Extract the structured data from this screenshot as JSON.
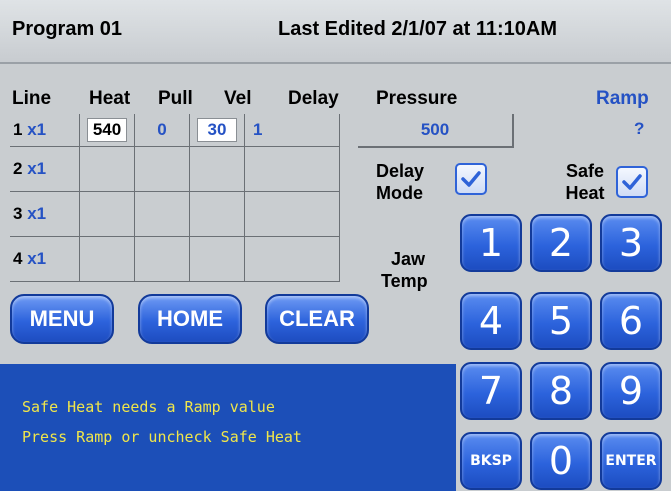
{
  "header": {
    "program_title": "Program 01",
    "last_edited": "Last Edited 2/1/07 at 11:10AM"
  },
  "table": {
    "columns": [
      "Line",
      "Heat",
      "Pull",
      "Vel",
      "Delay",
      "Pressure",
      "Ramp"
    ],
    "rows": [
      {
        "line": "1",
        "mult": "x1",
        "heat": "540",
        "pull": "0",
        "vel": "30",
        "delay": "1"
      },
      {
        "line": "2",
        "mult": "x1",
        "heat": "",
        "pull": "",
        "vel": "",
        "delay": ""
      },
      {
        "line": "3",
        "mult": "x1",
        "heat": "",
        "pull": "",
        "vel": "",
        "delay": ""
      },
      {
        "line": "4",
        "mult": "x1",
        "heat": "",
        "pull": "",
        "vel": "",
        "delay": ""
      }
    ],
    "pressure_value": "500",
    "ramp_value": "?"
  },
  "options": {
    "delay_mode_line1": "Delay",
    "delay_mode_line2": "Mode",
    "delay_mode_checked": true,
    "safe_heat_line1": "Safe",
    "safe_heat_line2": "Heat",
    "safe_heat_checked": true,
    "jaw_temp_line1": "Jaw",
    "jaw_temp_line2": "Temp"
  },
  "buttons": {
    "menu": "MENU",
    "home": "HOME",
    "clear": "CLEAR"
  },
  "keypad": {
    "k1": "1",
    "k2": "2",
    "k3": "3",
    "k4": "4",
    "k5": "5",
    "k6": "6",
    "k7": "7",
    "k8": "8",
    "k9": "9",
    "backspace": "BKSP",
    "k0": "0",
    "enter": "ENTER"
  },
  "message": {
    "line1": "Safe Heat needs a Ramp value",
    "line2": "Press Ramp or uncheck Safe Heat"
  },
  "colors": {
    "accent_blue": "#2552c4",
    "button_blue": "#2d63dc",
    "message_bg": "#1c4fb8",
    "message_text": "#f0e64a",
    "panel_bg": "#c9cdd0"
  }
}
